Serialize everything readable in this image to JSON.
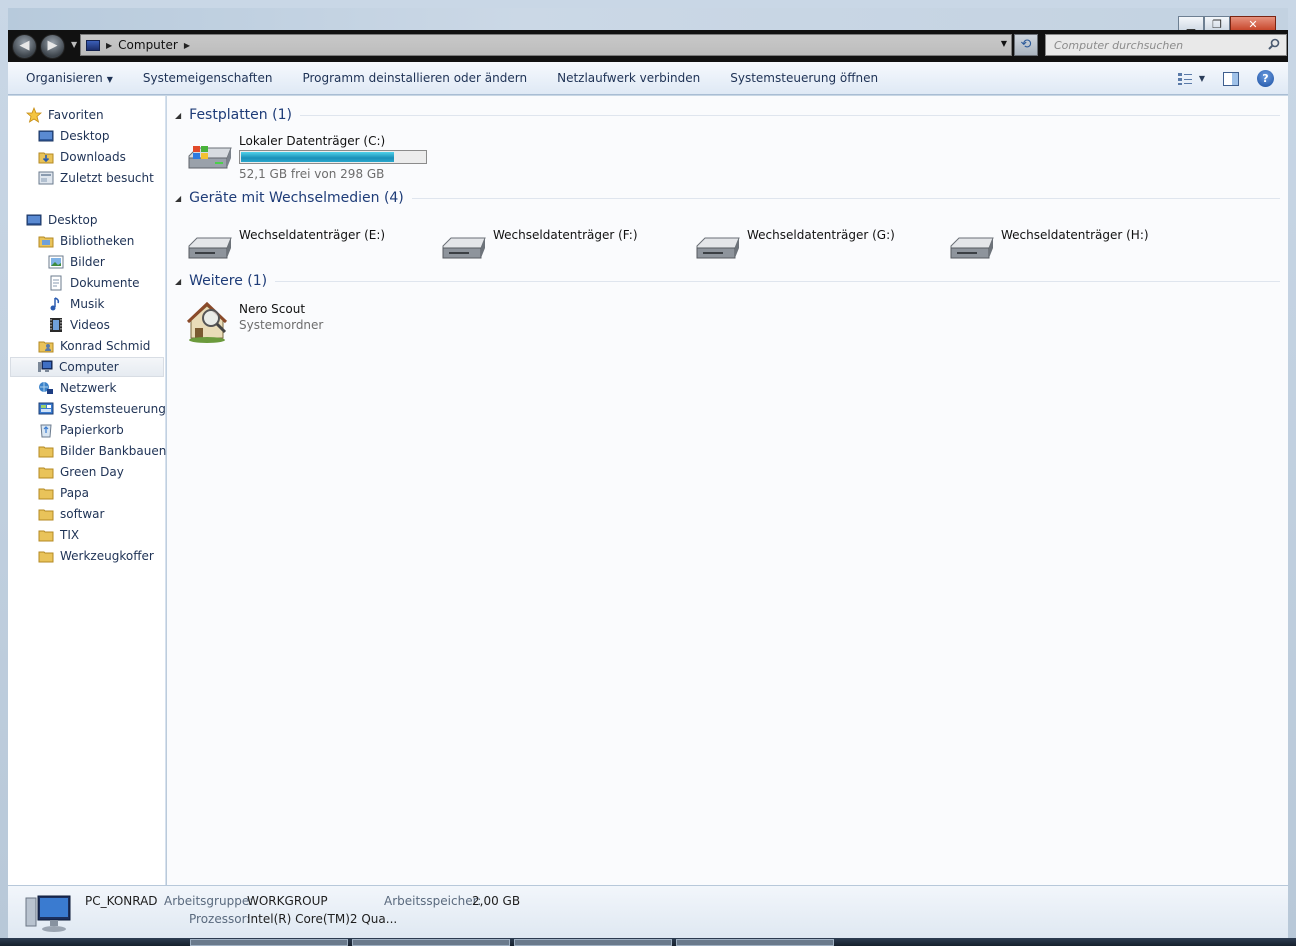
{
  "window": {
    "min_glyph": "▁",
    "max_glyph": "❐",
    "close_glyph": "✕"
  },
  "address": {
    "location": "Computer",
    "search_placeholder": "Computer durchsuchen"
  },
  "commands": [
    {
      "label": "Organisieren",
      "has_caret": true
    },
    {
      "label": "Systemeigenschaften"
    },
    {
      "label": "Programm deinstallieren oder ändern"
    },
    {
      "label": "Netzlaufwerk verbinden"
    },
    {
      "label": "Systemsteuerung öffnen"
    }
  ],
  "help_label": "?",
  "sidebar": {
    "favorites_header": "Favoriten",
    "favorites": [
      "Desktop",
      "Downloads",
      "Zuletzt besucht"
    ],
    "desktop_header": "Desktop",
    "items": [
      {
        "label": "Bibliotheken",
        "icon": "libraries-icon"
      },
      {
        "label": "Bilder",
        "icon": "pictures-icon"
      },
      {
        "label": "Dokumente",
        "icon": "documents-icon"
      },
      {
        "label": "Musik",
        "icon": "music-icon"
      },
      {
        "label": "Videos",
        "icon": "videos-icon"
      },
      {
        "label": "Konrad Schmid",
        "icon": "user-folder-icon"
      },
      {
        "label": "Computer",
        "icon": "computer-icon",
        "selected": true
      },
      {
        "label": "Netzwerk",
        "icon": "network-icon"
      },
      {
        "label": "Systemsteuerung",
        "icon": "control-panel-icon"
      },
      {
        "label": "Papierkorb",
        "icon": "recycle-bin-icon"
      },
      {
        "label": "Bilder Bankbauen",
        "icon": "folder-icon"
      },
      {
        "label": "Green Day",
        "icon": "folder-icon"
      },
      {
        "label": "Papa",
        "icon": "folder-icon"
      },
      {
        "label": "softwar",
        "icon": "folder-icon"
      },
      {
        "label": "TIX",
        "icon": "folder-icon"
      },
      {
        "label": "Werkzeugkoffer",
        "icon": "folder-icon"
      }
    ]
  },
  "groups": {
    "hard_drives": {
      "title": "Festplatten (1)",
      "drive": {
        "name": "Lokaler Datenträger (C:)",
        "free_text": "52,1 GB frei von 298 GB",
        "used_fraction": 0.825
      }
    },
    "removable": {
      "title": "Geräte mit Wechselmedien (4)",
      "drives": [
        "Wechseldatenträger (E:)",
        "Wechseldatenträger (F:)",
        "Wechseldatenträger (G:)",
        "Wechseldatenträger (H:)"
      ]
    },
    "other": {
      "title": "Weitere (1)",
      "item": {
        "name": "Nero Scout",
        "sub": "Systemordner"
      }
    }
  },
  "details": {
    "pc_name": "PC_KONRAD",
    "workgroup_label": "Arbeitsgruppe:",
    "workgroup_value": "WORKGROUP",
    "memory_label": "Arbeitsspeicher:",
    "memory_value": "2,00 GB",
    "cpu_label": "Prozessor:",
    "cpu_value": "Intel(R) Core(TM)2 Qua..."
  }
}
